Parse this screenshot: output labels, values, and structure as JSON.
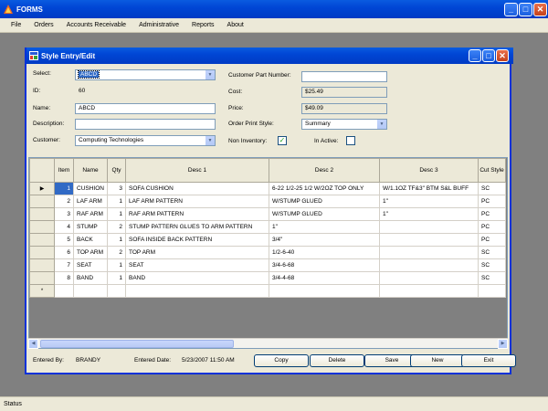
{
  "app": {
    "title": "FORMS",
    "menu": [
      "File",
      "Orders",
      "Accounts Receivable",
      "Administrative",
      "Reports",
      "About"
    ],
    "status": "Status"
  },
  "form": {
    "title": "Style Entry/Edit",
    "select_label": "Select:",
    "select_value": "ABCD",
    "id_label": "ID:",
    "id_value": "60",
    "name_label": "Name:",
    "name_value": "ABCD",
    "description_label": "Description:",
    "description_value": "",
    "customer_label": "Customer:",
    "customer_value": "Computing Technologies",
    "customer_part_label": "Customer Part Number:",
    "customer_part_value": "",
    "cost_label": "Cost:",
    "cost_value": "$25.49",
    "price_label": "Price:",
    "price_value": "$49.09",
    "order_print_label": "Order Print Style:",
    "order_print_value": "Summary",
    "non_inventory_label": "Non Inventory:",
    "non_inventory_checked": true,
    "inactive_label": "In Active:",
    "inactive_checked": false,
    "entered_by_label": "Entered By:",
    "entered_by_value": "BRANDY",
    "entered_date_label": "Entered Date:",
    "entered_date_value": "5/23/2007 11:50 AM",
    "buttons": {
      "copy": "Copy",
      "delete": "Delete",
      "save": "Save",
      "new": "New",
      "exit": "Exit"
    }
  },
  "grid": {
    "columns": [
      "Item",
      "Name",
      "Qty",
      "Desc 1",
      "Desc 2",
      "Desc 3",
      "Cut Style"
    ],
    "current_row_marker": "▶",
    "new_row_marker": "*",
    "rows": [
      {
        "item": "1",
        "name": "CUSHION",
        "qty": "3",
        "desc1": "SOFA CUSHION",
        "desc2": "6-22 1/2-25 1/2 W/2OZ TOP ONLY",
        "desc3": "W/1.1OZ TF&3\" BTM S&L BUFF",
        "cut": "SC"
      },
      {
        "item": "2",
        "name": "LAF ARM",
        "qty": "1",
        "desc1": "LAF ARM PATTERN",
        "desc2": "W/STUMP GLUED",
        "desc3": "1\"",
        "cut": "PC"
      },
      {
        "item": "3",
        "name": "RAF ARM",
        "qty": "1",
        "desc1": "RAF ARM PATTERN",
        "desc2": "W/STUMP GLUED",
        "desc3": "1\"",
        "cut": "PC"
      },
      {
        "item": "4",
        "name": "STUMP",
        "qty": "2",
        "desc1": "STUMP PATTERN GLUES TO ARM PATTERN",
        "desc2": "1\"",
        "desc3": "",
        "cut": "PC"
      },
      {
        "item": "5",
        "name": "BACK",
        "qty": "1",
        "desc1": "SOFA INSIDE BACK PATTERN",
        "desc2": "3/4\"",
        "desc3": "",
        "cut": "PC"
      },
      {
        "item": "6",
        "name": "TOP ARM",
        "qty": "2",
        "desc1": "TOP ARM",
        "desc2": "1/2-6-40",
        "desc3": "",
        "cut": "SC"
      },
      {
        "item": "7",
        "name": "SEAT",
        "qty": "1",
        "desc1": "SEAT",
        "desc2": "3/4-6-68",
        "desc3": "",
        "cut": "SC"
      },
      {
        "item": "8",
        "name": "BAND",
        "qty": "1",
        "desc1": "BAND",
        "desc2": "3/4-4-68",
        "desc3": "",
        "cut": "SC"
      }
    ]
  },
  "colors": {
    "titlebar": "#0046d5",
    "selection": "#316ac5",
    "mdi_background": "#808080",
    "dialog_face": "#ece9d8"
  }
}
